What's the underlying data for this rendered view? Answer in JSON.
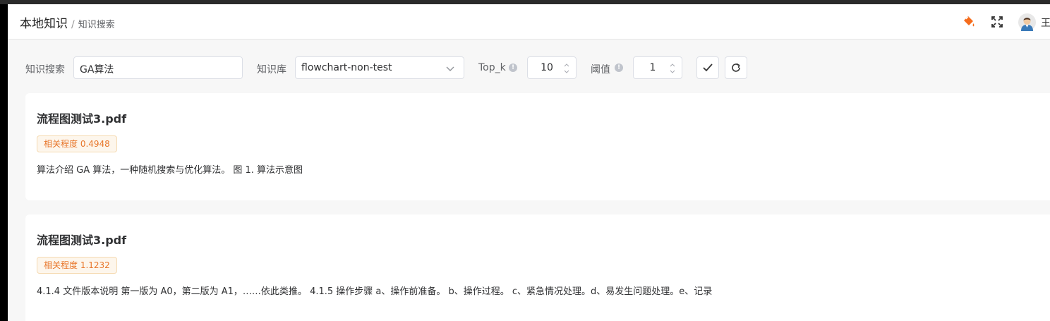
{
  "header": {
    "breadcrumb_main": "本地知识",
    "breadcrumb_sep": "/",
    "breadcrumb_sub": "知识搜索",
    "user_name": "王",
    "icons": [
      "paint-bucket-icon",
      "fullscreen-icon",
      "user-avatar"
    ]
  },
  "search_form": {
    "query_label": "知识搜索",
    "query_value": "GA算法",
    "kb_label": "知识库",
    "kb_value": "flowchart-non-test",
    "topk_label": "Top_k",
    "topk_value": "10",
    "threshold_label": "阈值",
    "threshold_value": "1",
    "info_icon_glyph": "!"
  },
  "results": [
    {
      "title": "流程图测试3.pdf",
      "score": "相关程度 0.4948",
      "content": "算法介绍 GA 算法，一种随机搜索与优化算法。 图 1. 算法示意图"
    },
    {
      "title": "流程图测试3.pdf",
      "score": "相关程度 1.1232",
      "content": "4.1.4 文件版本说明 第一版为 A0，第二版为 A1，……依此类推。 4.1.5 操作步骤 a、操作前准备。 b、操作过程。 c、紧急情况处理。d、易发生问题处理。e、记录"
    }
  ],
  "colors": {
    "accent": "#f56c1c",
    "tag_bg": "#fdf6ec",
    "tag_border": "#f5dab1"
  }
}
